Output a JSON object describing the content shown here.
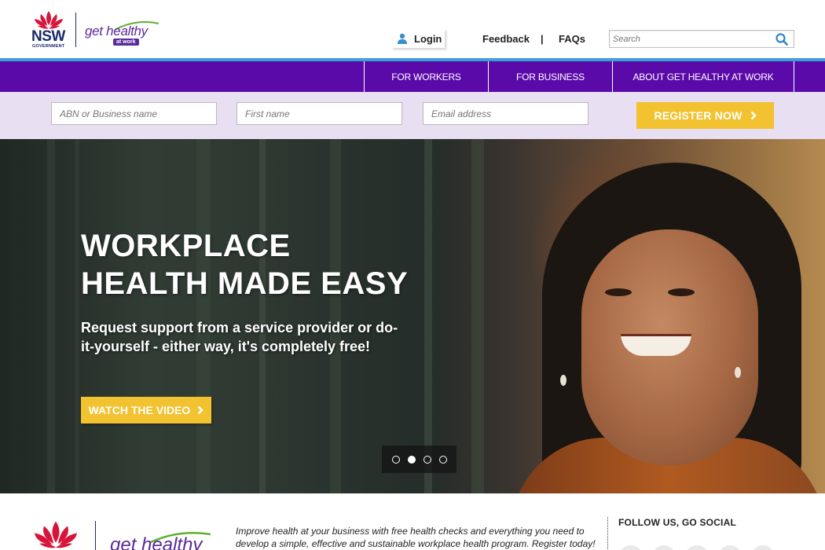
{
  "header": {
    "logo_nsw": "NSW",
    "logo_government": "GOVERNMENT",
    "logo_get_healthy": "get healthy",
    "logo_at_work": "at work",
    "login_label": "Login",
    "feedback_label": "Feedback",
    "separator": "|",
    "faqs_label": "FAQs",
    "search_placeholder": "Search"
  },
  "nav": {
    "items": [
      {
        "label": "FOR WORKERS"
      },
      {
        "label": "FOR BUSINESS"
      },
      {
        "label": "ABOUT GET HEALTHY AT WORK"
      }
    ]
  },
  "register": {
    "abn_placeholder": "ABN or Business name",
    "first_name_placeholder": "First name",
    "email_placeholder": "Email address",
    "button_label": "REGISTER NOW"
  },
  "hero": {
    "title_line1": "WORKPLACE",
    "title_line2": "HEALTH MADE EASY",
    "subtitle": "Request support from a service provider or do-it-yourself - either way, it's completely free!",
    "video_button_label": "WATCH THE VIDEO",
    "slides_total": 4,
    "slide_active": 2
  },
  "footer": {
    "logo_get_healthy": "get healthy",
    "intro": "Improve health at your business with free health checks and everything you need to develop a simple, effective and sustainable workplace health program. Register today!",
    "follow_heading": "FOLLOW US, GO SOCIAL"
  },
  "colors": {
    "nav_purple": "#5b0aaa",
    "accent_blue": "#3aa0d8",
    "cta_yellow": "#f2c230",
    "register_band": "#e8dff3",
    "nsw_red": "#d7153a",
    "nsw_navy": "#1a2a6c"
  },
  "icons": {
    "login": "user-icon",
    "search": "search-icon",
    "register_arrow": "chevron-right-icon",
    "video_arrow": "chevron-right-icon",
    "logo": "waratah-icon"
  }
}
